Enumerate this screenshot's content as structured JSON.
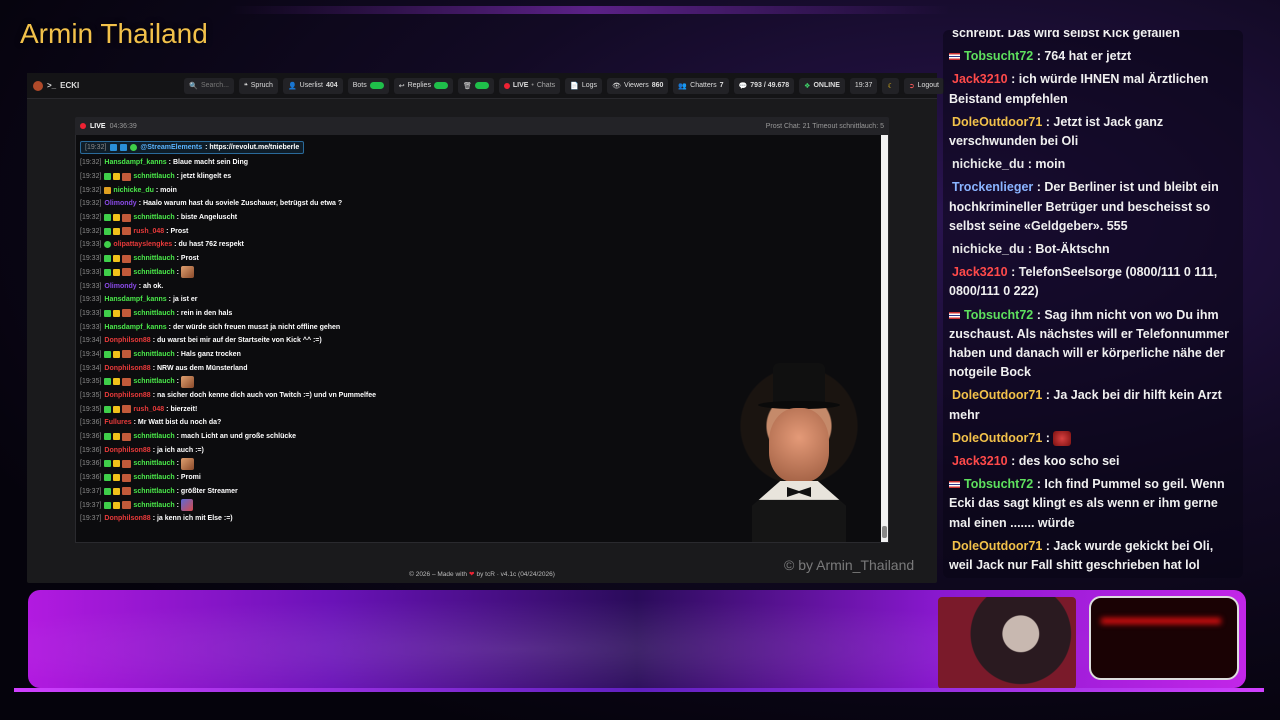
{
  "overlay": {
    "title": "Armin Thailand",
    "watermark": "© by Armin_Thailand"
  },
  "appbar": {
    "brand": "ECKI",
    "search_placeholder": "Search...",
    "items": [
      {
        "label": "Spruch",
        "icon": "quote-icon"
      },
      {
        "label": "Userlist",
        "count": "404",
        "icon": "user-icon"
      },
      {
        "label": "Bots",
        "icon": "bot-icon"
      },
      {
        "label": "Replies",
        "icon": "reply-icon"
      },
      {
        "label": "",
        "icon": "trash-icon"
      }
    ],
    "live_chats": {
      "live": "LIVE",
      "sep": " • ",
      "chats": "Chats"
    },
    "logs": "Logs",
    "viewers_label": "Viewers",
    "viewers_value": "860",
    "chatters_label": "Chatters",
    "chatters_value": "7",
    "messages": "793 / 49.678",
    "online": "ONLINE",
    "time": "19:37",
    "logout": "Logout",
    "accent_green": "#1fbf4a"
  },
  "chat_header": {
    "live": "LIVE",
    "duration": "04:36:39",
    "right": "Prost Chat: 21  Timeout schnittlauch: 5"
  },
  "pinned": {
    "ts": "[19:32]",
    "user": "@StreamElements",
    "text": ": https://revolut.me/tnieberle"
  },
  "messages": [
    {
      "ts": "[19:32]",
      "badges": [],
      "user": "Hansdampf_kanns",
      "color": "#4ae84a",
      "text": ": Blaue macht sein Ding"
    },
    {
      "ts": "[19:32]",
      "badges": [
        "green",
        "yellow",
        "avatar"
      ],
      "user": "schnittlauch",
      "color": "#4ae84a",
      "text": ": jetzt klingelt es"
    },
    {
      "ts": "[19:32]",
      "badges": [
        "crown"
      ],
      "user": "nichicke_du",
      "color": "#4ae84a",
      "text": ": moin"
    },
    {
      "ts": "[19:32]",
      "badges": [],
      "user": "Olimondy",
      "color": "#8a4ae8",
      "text": ": Haalo warum hast du soviele Zuschauer, betrügst du etwa ?"
    },
    {
      "ts": "[19:32]",
      "badges": [
        "green",
        "yellow",
        "avatar"
      ],
      "user": "schnittlauch",
      "color": "#4ae84a",
      "text": ": biste Angeluscht"
    },
    {
      "ts": "[19:32]",
      "badges": [
        "green",
        "yellow",
        "avatar"
      ],
      "user": "rush_048",
      "color": "#e83a3a",
      "text": ": Prost"
    },
    {
      "ts": "[19:33]",
      "badges": [
        "round"
      ],
      "user": "olipattayslengkes",
      "color": "#e83a3a",
      "text": ": du hast 762 respekt"
    },
    {
      "ts": "[19:33]",
      "badges": [
        "green",
        "yellow",
        "avatar"
      ],
      "user": "schnittlauch",
      "color": "#4ae84a",
      "text": ": Prost"
    },
    {
      "ts": "[19:33]",
      "badges": [
        "green",
        "yellow",
        "avatar"
      ],
      "user": "schnittlauch",
      "color": "#4ae84a",
      "text": ": ",
      "emote": true
    },
    {
      "ts": "[19:33]",
      "badges": [],
      "user": "Olimondy",
      "color": "#8a4ae8",
      "text": ": ah ok."
    },
    {
      "ts": "[19:33]",
      "badges": [],
      "user": "Hansdampf_kanns",
      "color": "#4ae84a",
      "text": ": ja ist er"
    },
    {
      "ts": "[19:33]",
      "badges": [
        "green",
        "yellow",
        "avatar"
      ],
      "user": "schnittlauch",
      "color": "#4ae84a",
      "text": ": rein in den hals"
    },
    {
      "ts": "[19:33]",
      "badges": [],
      "user": "Hansdampf_kanns",
      "color": "#4ae84a",
      "text": ": der würde sich freuen musst ja nicht offline gehen"
    },
    {
      "ts": "[19:34]",
      "badges": [],
      "user": "Donphilson88",
      "color": "#e83a3a",
      "text": ": du warst bei mir auf der Startseite von Kick ^^ :=)"
    },
    {
      "ts": "[19:34]",
      "badges": [
        "green",
        "yellow",
        "avatar"
      ],
      "user": "schnittlauch",
      "color": "#4ae84a",
      "text": ": Hals ganz trocken"
    },
    {
      "ts": "[19:34]",
      "badges": [],
      "user": "Donphilson88",
      "color": "#e83a3a",
      "text": ": NRW aus dem Münsterland"
    },
    {
      "ts": "[19:35]",
      "badges": [
        "green",
        "yellow",
        "avatar"
      ],
      "user": "schnittlauch",
      "color": "#4ae84a",
      "text": ": ",
      "emote": true
    },
    {
      "ts": "[19:35]",
      "badges": [],
      "user": "Donphilson88",
      "color": "#e83a3a",
      "text": ": na sicher doch kenne dich auch von Twitch :=) und vn Pummelfee"
    },
    {
      "ts": "[19:35]",
      "badges": [
        "green",
        "yellow",
        "avatar"
      ],
      "user": "rush_048",
      "color": "#e83a3a",
      "text": ": bierzeit!"
    },
    {
      "ts": "[19:36]",
      "badges": [],
      "user": "Fullures",
      "color": "#e83a3a",
      "text": ": Mr Watt bist du noch da?"
    },
    {
      "ts": "[19:36]",
      "badges": [
        "green",
        "yellow",
        "avatar"
      ],
      "user": "schnittlauch",
      "color": "#4ae84a",
      "text": ": mach Licht an und große schlücke"
    },
    {
      "ts": "[19:36]",
      "badges": [],
      "user": "Donphilson88",
      "color": "#e83a3a",
      "text": ": ja ich auch :=)"
    },
    {
      "ts": "[19:36]",
      "badges": [
        "green",
        "yellow",
        "avatar"
      ],
      "user": "schnittlauch",
      "color": "#4ae84a",
      "text": ": ",
      "emote": true
    },
    {
      "ts": "[19:36]",
      "badges": [
        "green",
        "yellow",
        "avatar"
      ],
      "user": "schnittlauch",
      "color": "#4ae84a",
      "text": ": Promi"
    },
    {
      "ts": "[19:37]",
      "badges": [
        "green",
        "yellow",
        "avatar"
      ],
      "user": "schnittlauch",
      "color": "#4ae84a",
      "text": ": größter Streamer"
    },
    {
      "ts": "[19:37]",
      "badges": [
        "green",
        "yellow",
        "avatar"
      ],
      "user": "schnittlauch",
      "color": "#4ae84a",
      "text": ": ",
      "emote2": true
    },
    {
      "ts": "[19:37]",
      "badges": [],
      "user": "Donphilson88",
      "color": "#e83a3a",
      "text": ": ja kenn ich mit Else :=)"
    }
  ],
  "footer": {
    "pre": "© 2026 – Made with",
    "post": "by tcR · v4.1c (04/24/2026)"
  },
  "stream_chat": [
    {
      "flag": false,
      "user": "",
      "cls": "u-white",
      "text": "schreibt. Das wird selbst Kick gefallen"
    },
    {
      "flag": true,
      "user": "Tobsucht72",
      "cls": "u-green",
      "text": " : 764 hat er jetzt"
    },
    {
      "flag": false,
      "user": "Jack3210",
      "cls": "u-red",
      "text": " : ich würde IHNEN mal Ärztlichen Beistand empfehlen"
    },
    {
      "flag": false,
      "user": "DoleOutdoor71",
      "cls": "u-yellow",
      "text": " : Jetzt ist Jack ganz verschwunden bei Oli"
    },
    {
      "flag": false,
      "user": "nichicke_du",
      "cls": "u-white",
      "text": " : moin"
    },
    {
      "flag": false,
      "user": "Trockenlieger",
      "cls": "u-blue",
      "text": " : Der Berliner ist und bleibt ein hochkrimineller Betrüger und bescheisst so selbst seine «Geldgeber». 555"
    },
    {
      "flag": false,
      "user": "nichicke_du",
      "cls": "u-white",
      "text": " : Bot-Äktschn"
    },
    {
      "flag": false,
      "user": "Jack3210",
      "cls": "u-red",
      "text": " : TelefonSeelsorge (0800/111 0 111, 0800/111 0 222)"
    },
    {
      "flag": true,
      "user": "Tobsucht72",
      "cls": "u-green",
      "text": " : Sag ihm nicht von wo Du ihm zuschaust. Als nächstes will er Telefonnummer haben und danach will er körperliche nähe der notgeile Bock"
    },
    {
      "flag": false,
      "user": "DoleOutdoor71",
      "cls": "u-yellow",
      "text": " : Ja Jack bei dir hilft kein Arzt mehr"
    },
    {
      "flag": false,
      "user": "DoleOutdoor71",
      "cls": "u-yellow",
      "text": " : ",
      "emote": true
    },
    {
      "flag": false,
      "user": "Jack3210",
      "cls": "u-red",
      "text": " : des koo scho sei"
    },
    {
      "flag": true,
      "user": "Tobsucht72",
      "cls": "u-green",
      "text": " : Ich find Pummel so geil. Wenn Ecki das sagt klingt es als wenn er ihm gerne mal einen ....... würde"
    },
    {
      "flag": false,
      "user": "DoleOutdoor71",
      "cls": "u-yellow",
      "text": " : Jack wurde gekickt bei Oli, weil Jack nur Fall shitt geschrieben hat lol"
    }
  ]
}
